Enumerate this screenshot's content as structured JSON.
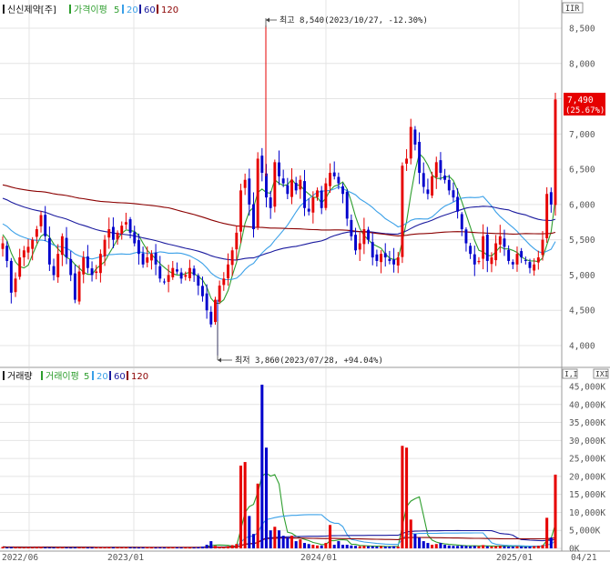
{
  "colors": {
    "up": "#e60000",
    "down": "#0000cc",
    "ma5": "#2e9e2e",
    "ma20": "#3aa0e8",
    "ma60": "#1a1a9e",
    "ma120": "#8b0000",
    "grid": "#e4e4e4",
    "axis": "#9a9a9a"
  },
  "price_legend": {
    "title": "신신제약[주]",
    "ma_label": "가격이평",
    "ma_periods": [
      "5",
      "20",
      "60",
      "120"
    ]
  },
  "volume_legend": {
    "title": "거래량",
    "ma_label": "거래이평",
    "ma_periods": [
      "5",
      "20",
      "60",
      "120"
    ]
  },
  "corner_icons": {
    "price_panel": "IIR",
    "volume_panel_a": "I,I",
    "volume_panel_b": "IXI"
  },
  "annotations": {
    "high": "최고 8,540(2023/10/27, -12.30%)",
    "low": "최저 3,860(2023/07/28, +94.04%)",
    "last_price": "7,490",
    "last_change": "(25.67%)"
  },
  "price_axis_ticks": [
    "8,500",
    "8,000",
    "7,500",
    "7,000",
    "6,500",
    "6,000",
    "5,500",
    "5,000",
    "4,500",
    "4,000"
  ],
  "volume_axis_ticks": [
    "45,000K",
    "40,000K",
    "35,000K",
    "30,000K",
    "25,000K",
    "20,000K",
    "15,000K",
    "10,000K",
    "5,000K",
    "0K"
  ],
  "date_ticks": [
    "2022/06",
    "2023/01",
    "2024/01",
    "2025/01",
    "04/21"
  ],
  "chart_data": [
    {
      "type": "candlestick",
      "title": "신신제약[주]",
      "ylim": [
        3700,
        8750
      ],
      "yticks": [
        8500,
        8000,
        7500,
        7000,
        6500,
        6000,
        5500,
        5000,
        4500,
        4000
      ],
      "grid": true,
      "moving_averages": [
        "5",
        "20",
        "60",
        "120"
      ],
      "closes": [
        5450,
        5200,
        4750,
        4950,
        5250,
        5350,
        5400,
        5500,
        5650,
        5850,
        5550,
        5150,
        5000,
        5300,
        5550,
        5250,
        5000,
        4650,
        5050,
        5250,
        5100,
        5000,
        5050,
        5300,
        5500,
        5650,
        5500,
        5600,
        5700,
        5750,
        5600,
        5450,
        5300,
        5150,
        5250,
        5300,
        5150,
        4950,
        4900,
        5000,
        5100,
        5050,
        4950,
        5000,
        5100,
        5000,
        4850,
        4700,
        4500,
        4300,
        4650,
        4850,
        4950,
        5150,
        5350,
        5600,
        6200,
        6350,
        6000,
        5650,
        6650,
        6450,
        6100,
        5950,
        6600,
        6400,
        6300,
        6150,
        6350,
        6200,
        6350,
        5950,
        5900,
        6100,
        6200,
        5950,
        6300,
        6450,
        6400,
        6300,
        6150,
        5800,
        5550,
        5350,
        5450,
        5650,
        5500,
        5250,
        5200,
        5300,
        5250,
        5200,
        5150,
        5250,
        6550,
        6650,
        7100,
        6850,
        6450,
        6250,
        6150,
        6400,
        6600,
        6450,
        6350,
        6200,
        6100,
        5900,
        5650,
        5450,
        5300,
        5150,
        5200,
        5550,
        5200,
        5250,
        5450,
        5550,
        5400,
        5200,
        5150,
        5300,
        5250,
        5200,
        5100,
        5150,
        5250,
        5500,
        6150,
        6000,
        7490
      ],
      "annotations": {
        "high": {
          "value": 8540,
          "date": "2023/10/27"
        },
        "low": {
          "value": 3860,
          "date": "2023/07/28"
        },
        "last": 7490
      }
    },
    {
      "type": "bar",
      "title": "거래량",
      "unit": "K",
      "ylim": [
        0,
        47000
      ],
      "yticks": [
        45000,
        40000,
        35000,
        30000,
        25000,
        20000,
        15000,
        10000,
        5000,
        0
      ],
      "grid": true,
      "moving_averages": [
        "5",
        "20",
        "60",
        "120"
      ],
      "values": [
        400,
        300,
        350,
        300,
        250,
        280,
        320,
        300,
        350,
        400,
        300,
        260,
        250,
        280,
        300,
        260,
        240,
        300,
        250,
        260,
        240,
        230,
        250,
        260,
        300,
        320,
        280,
        260,
        280,
        300,
        260,
        240,
        230,
        250,
        260,
        240,
        230,
        260,
        240,
        230,
        250,
        260,
        240,
        230,
        220,
        240,
        300,
        500,
        1000,
        2000,
        700,
        450,
        400,
        600,
        900,
        1200,
        23000,
        24000,
        9000,
        4000,
        18000,
        45500,
        28000,
        5000,
        6000,
        5000,
        3500,
        3000,
        3500,
        2000,
        2500,
        1500,
        1200,
        1000,
        800,
        800,
        1500,
        6500,
        1000,
        2000,
        1000,
        1000,
        800,
        700,
        600,
        700,
        600,
        600,
        500,
        600,
        500,
        500,
        600,
        500,
        28500,
        28000,
        8000,
        4000,
        3000,
        2000,
        1500,
        1000,
        1200,
        1500,
        1000,
        800,
        700,
        700,
        800,
        700,
        600,
        700,
        600,
        900,
        600,
        500,
        600,
        700,
        600,
        500,
        500,
        600,
        500,
        400,
        500,
        600,
        700,
        900,
        8500,
        3000,
        20500
      ]
    }
  ]
}
